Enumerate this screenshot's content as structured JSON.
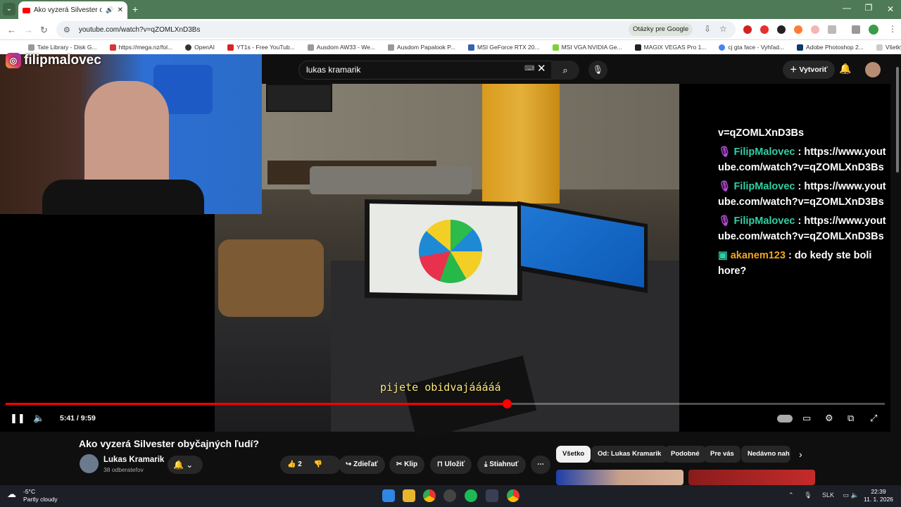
{
  "browser": {
    "tab_title": "Ako vyzerá Silvester obyčajn...",
    "url": "youtube.com/watch?v=qZOMLXnD3Bs",
    "ask_google": "Otázky pre Google",
    "bookmarks": [
      "Tate Library - Disk G...",
      "https://mega.nz/fol...",
      "OpenAI",
      "YT1s - Free YouTub...",
      "Ausdom AW33 - We...",
      "Ausdom Papalook P...",
      "MSI GeForce RTX 20...",
      "MSI VGA NVIDIA Ge...",
      "MAGIX VEGAS Pro 1...",
      "cj gta face - Vyhľad...",
      "Adobe Photoshop 2..."
    ],
    "all_bookmarks": "Všetky záložky"
  },
  "youtube": {
    "search_value": "lukas kramarik",
    "create_label": "Vytvoriť"
  },
  "stream": {
    "instagram_handle": "filipmalovec",
    "caption": "pijete obidvajááááá",
    "chat": [
      {
        "user": "",
        "text": "v=qZOMLXnD3Bs",
        "partial": true
      },
      {
        "user": "FilipMalovec",
        "text": "https://www.youtube.com/watch?v=qZOMLXnD3Bs"
      },
      {
        "user": "FilipMalovec",
        "text": "https://www.youtube.com/watch?v=qZOMLXnD3Bs"
      },
      {
        "user": "FilipMalovec",
        "text": "https://www.youtube.com/watch?v=qZOMLXnD3Bs"
      },
      {
        "user": "akanem123",
        "text": "do kedy ste boli hore?"
      }
    ]
  },
  "player": {
    "time": "5:41 / 9:59",
    "progress": 0.57
  },
  "video": {
    "title": "Ako vyzerá Silvester obyčajných ľudí?",
    "channel": "Lukas Kramarik",
    "subscribers": "38 odberateľov",
    "likes": "2",
    "share": "Zdieľať",
    "clip": "Klip",
    "save": "Uložiť",
    "download": "Stiahnuť"
  },
  "chips": [
    "Všetko",
    "Od: Lukas Kramarik",
    "Podobné",
    "Pre vás",
    "Nedávno nah"
  ],
  "taskbar": {
    "temp": "-5°C",
    "weather": "Partly cloudy",
    "lang": "SLK",
    "time": "22:39",
    "date": "11. 1. 2026"
  },
  "colors": {
    "accent": "#ff0000",
    "chat_name": "#31d0a4",
    "chat_name_alt": "#f3a51f",
    "tab_bar": "#4e7a57"
  }
}
